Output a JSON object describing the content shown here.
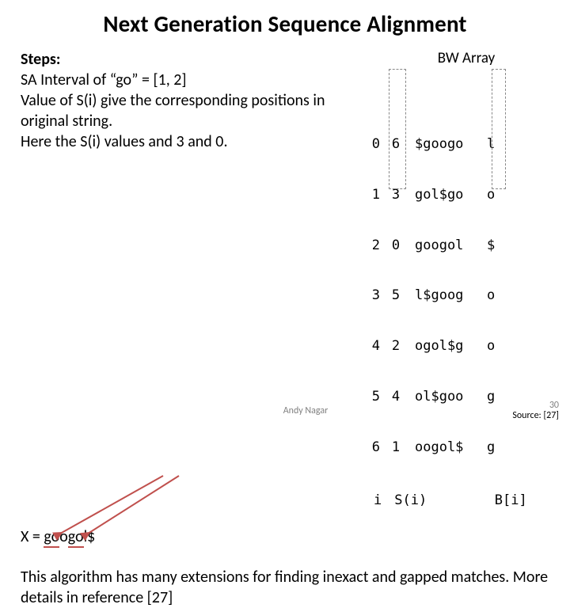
{
  "title": "Next Generation Sequence Alignment",
  "steps": {
    "label": "Steps:",
    "line1": "SA Interval of “go” = [1, 2]",
    "line2": "Value of S(i) give the corresponding positions in original string.",
    "line3": "Here the S(i) values and 3 and 0."
  },
  "googol": {
    "prefix": "X = ",
    "p1": "go",
    "p2": "o",
    "p3": "go",
    "p4": "l$"
  },
  "bw": {
    "label": "BW Array",
    "rows": [
      {
        "i": "0",
        "s": "6",
        "rot": "$googo",
        "b": "l"
      },
      {
        "i": "1",
        "s": "3",
        "rot": "gol$go",
        "b": "o"
      },
      {
        "i": "2",
        "s": "0",
        "rot": "googol",
        "b": "$"
      },
      {
        "i": "3",
        "s": "5",
        "rot": "l$goog",
        "b": "o"
      },
      {
        "i": "4",
        "s": "2",
        "rot": "ogol$g",
        "b": "o"
      },
      {
        "i": "5",
        "s": "4",
        "rot": "ol$goo",
        "b": "g"
      },
      {
        "i": "6",
        "s": "1",
        "rot": "oogol$",
        "b": "g"
      }
    ],
    "axis": {
      "i": "i",
      "s": "S(i)",
      "b": "B[i]"
    }
  },
  "algo_note": "This algorithm has many extensions for finding inexact and gapped matches. More details in reference [27]",
  "footer": {
    "author": "Andy Nagar",
    "page": "30",
    "source": "Source: [27]"
  }
}
